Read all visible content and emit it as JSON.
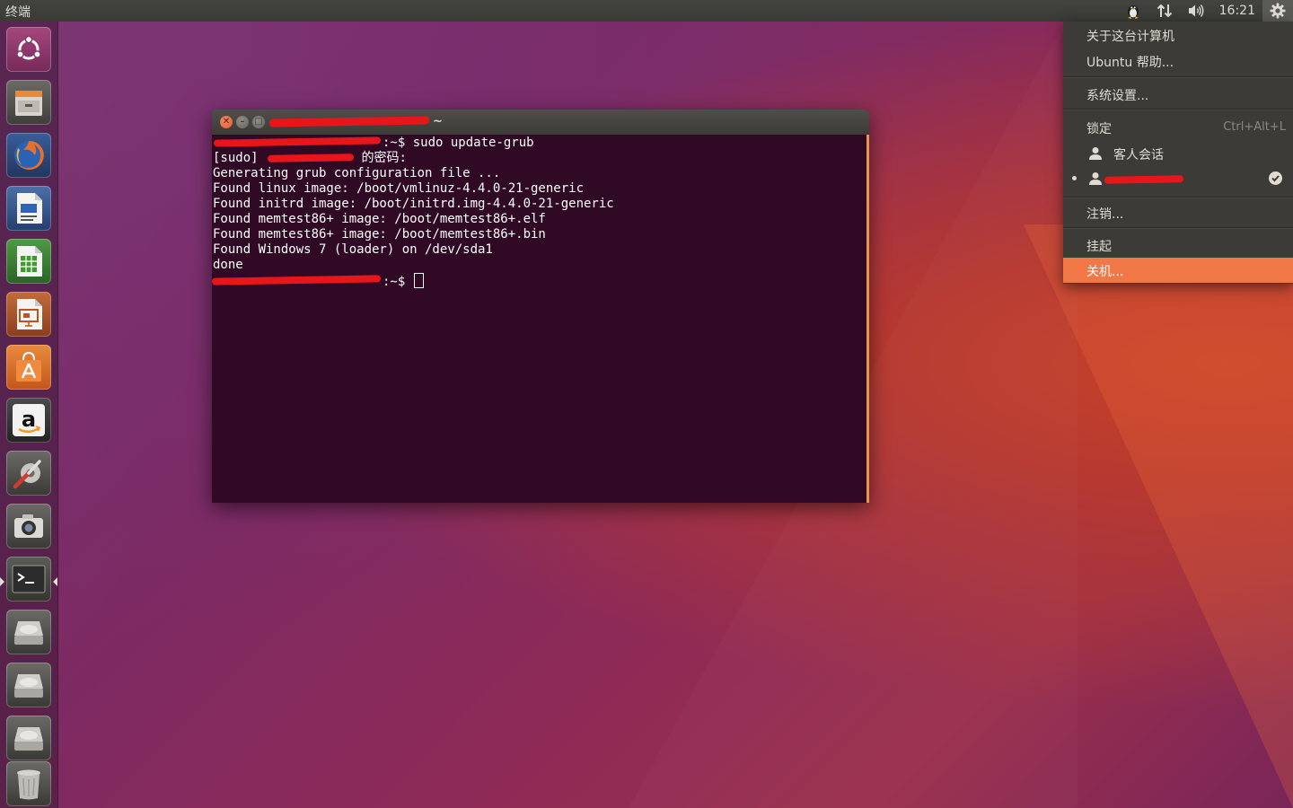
{
  "panel": {
    "app_name": "终端",
    "clock": "16:21"
  },
  "icons": {
    "keyboard": "tux-icon",
    "network": "network-updown-icon",
    "sound": "speaker-icon",
    "session": "gear-icon"
  },
  "launcher": {
    "items": [
      {
        "name": "dash-home",
        "icon": "ubuntu-logo-icon"
      },
      {
        "name": "files",
        "icon": "file-cabinet-icon"
      },
      {
        "name": "firefox",
        "icon": "firefox-icon"
      },
      {
        "name": "writer",
        "icon": "libreoffice-writer-icon"
      },
      {
        "name": "calc",
        "icon": "libreoffice-calc-icon"
      },
      {
        "name": "impress",
        "icon": "libreoffice-impress-icon"
      },
      {
        "name": "software-center",
        "icon": "shopping-bag-icon"
      },
      {
        "name": "amazon",
        "icon": "amazon-icon"
      },
      {
        "name": "system-settings",
        "icon": "wrench-gear-icon"
      },
      {
        "name": "camera",
        "icon": "camera-icon"
      },
      {
        "name": "terminal",
        "icon": "terminal-icon",
        "running": true
      },
      {
        "name": "drive-1",
        "icon": "hard-drive-icon"
      },
      {
        "name": "drive-2",
        "icon": "hard-drive-icon"
      },
      {
        "name": "drive-3",
        "icon": "hard-drive-icon"
      },
      {
        "name": "trash",
        "icon": "trash-icon"
      }
    ]
  },
  "terminal": {
    "title_suffix": "~",
    "lines": {
      "l1": ":~$ sudo update-grub",
      "l2a": "[sudo] ",
      "l2b": " 的密码:",
      "l3": "Generating grub configuration file ...",
      "l4": "Found linux image: /boot/vmlinuz-4.4.0-21-generic",
      "l5": "Found initrd image: /boot/initrd.img-4.4.0-21-generic",
      "l6": "Found memtest86+ image: /boot/memtest86+.elf",
      "l7": "Found memtest86+ image: /boot/memtest86+.bin",
      "l8": "Found Windows 7 (loader) on /dev/sda1",
      "l9": "done",
      "l10": ":~$ "
    }
  },
  "session_menu": {
    "about": "关于这台计算机",
    "help": "Ubuntu 帮助...",
    "settings": "系统设置...",
    "lock": "锁定",
    "lock_shortcut": "Ctrl+Alt+L",
    "guest": "客人会话",
    "logout": "注销...",
    "suspend": "挂起",
    "shutdown": "关机..."
  },
  "colors": {
    "accent": "#f07746",
    "terminal_bg": "#300a24",
    "redaction": "#e8161a"
  }
}
